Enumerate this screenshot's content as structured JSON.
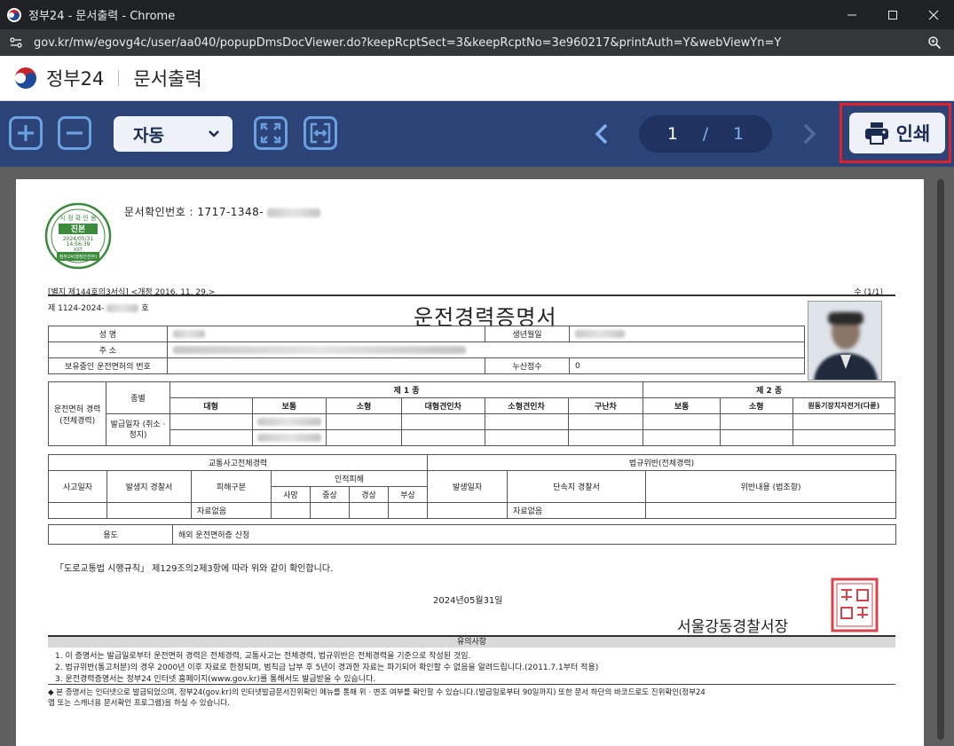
{
  "window": {
    "title": "정부24 - 문서출력 - Chrome",
    "url": "gov.kr/mw/egovg4c/user/aa040/popupDmsDocViewer.do?keepRcptSect=3&keepRcptNo=3e960217&printAuth=Y&webViewYn=Y",
    "minimize_icon": "minimize-icon",
    "maximize_icon": "maximize-icon",
    "close_icon": "close-icon"
  },
  "site": {
    "brand": "정부24",
    "page_title": "문서출력"
  },
  "toolbar": {
    "zoom_value": "자동",
    "current_page": "1",
    "page_separator": "/",
    "total_pages": "1",
    "print_label": "인쇄",
    "accent_color": "#2c4377",
    "highlight_color": "#e0202a"
  },
  "document": {
    "confirm_label": "문서확인번호 : 1717-1348-",
    "seal_lines": [
      "시 정 확 인 용",
      "진본",
      "2024/05/31",
      "14:56:39",
      "KST",
      "정부24(행정안전부)"
    ],
    "form_no": "[별지 제144호의3서식] <개정 2016. 11. 29.>",
    "page_count": "수 (1/1)",
    "doc_no_prefix": "제 1124-2024-",
    "doc_no_suffix": "호",
    "title": "운전경력증명서",
    "labels": {
      "name": "성    명",
      "birth": "생년월일",
      "address": "주    소",
      "license_no": "보유중인 운전면허의 번호",
      "points": "누산점수",
      "points_value": "0",
      "license_history": "운전면허 경력 (전체경력)",
      "type": "종별",
      "class1": "제 1 종",
      "class2": "제 2 종",
      "issue_date": "발급일자 (취소 · 정지)",
      "accident_history": "교통사고전체경력",
      "violation_history": "법규위반(전체경력)",
      "accident_date": "사고일자",
      "police_station": "발생지 경찰서",
      "damage_type": "피해구분",
      "injury": "인적피해",
      "violation_date": "발생일자",
      "enforcement_station": "단속지 경찰서",
      "violation_content": "위반내용 (법조항)",
      "no_data_1": "자료없음",
      "no_data_2": "자료없음",
      "purpose": "용도",
      "purpose_value": "해외 운전면허증 신청"
    },
    "class1_types": [
      "대형",
      "보통",
      "소형",
      "대형견인차",
      "소형견인차",
      "구난차"
    ],
    "class2_types": [
      "보통",
      "소형",
      "원동기장치자전거(다륜)"
    ],
    "injury_types": [
      "사망",
      "중상",
      "경상",
      "부상"
    ],
    "law_text": "「도로교통법 시행규칙」 제129조의2제3항에 따라 위와 같이 확인합니다.",
    "issue_date": "2024년05월31일",
    "issuer": "서울강동경찰서장",
    "stamp_text": "서울강동경찰서장인",
    "notice_title": "유의사항",
    "notices": [
      "1. 이 증명서는 발급일로부터 운전면허 경력은 전체경력, 교통사고는 전체경력, 법규위반은 전체경력을 기준으로 작성된 것임.",
      "2. 법규위반(통고처분)의 경우 2000년 이후 자료로 한정되며, 범칙금 납부 후 5년이 경과한 자료는 파기되어 확인할 수 없음을 알려드립니다.(2011.7.1부터 적용)",
      "3. 운전경력증명서는 정부24 인터넷 홈페이지(www.gov.kr)를 통해서도 발급받을 수 있습니다."
    ],
    "footnote_line1": "◆ 본 증명서는 인터넷으로 발급되었으며, 정부24(gov.kr)의 인터넷발급문서진위확인 메뉴를 통해 위 · 변조 여부를 확인할 수 있습니다.(발급일로부터 90일까지) 또한 문서 하단의 바코드로도 진위확인(정부24",
    "footnote_line2": "앱 또는 스캐너용 문서확인 프로그램)을 하실 수 있습니다."
  }
}
